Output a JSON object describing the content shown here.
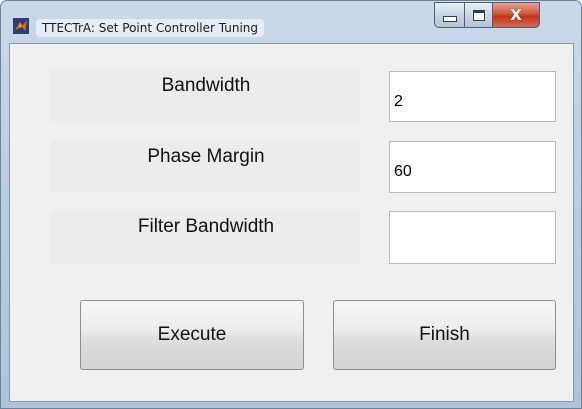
{
  "window": {
    "title": "TTECTrA: Set Point Controller Tuning",
    "icon": "matlab-icon",
    "controls": {
      "close_glyph": "X"
    }
  },
  "form": {
    "fields": [
      {
        "label": "Bandwidth",
        "value": "2"
      },
      {
        "label": "Phase Margin",
        "value": "60"
      },
      {
        "label": "Filter Bandwidth",
        "value": ""
      }
    ]
  },
  "buttons": {
    "execute": "Execute",
    "finish": "Finish"
  },
  "colors": {
    "client_bg": "#f0f0f0",
    "label_bg": "#ececec",
    "close_button": "#c4321b",
    "title_bar": "#bccfe2"
  }
}
